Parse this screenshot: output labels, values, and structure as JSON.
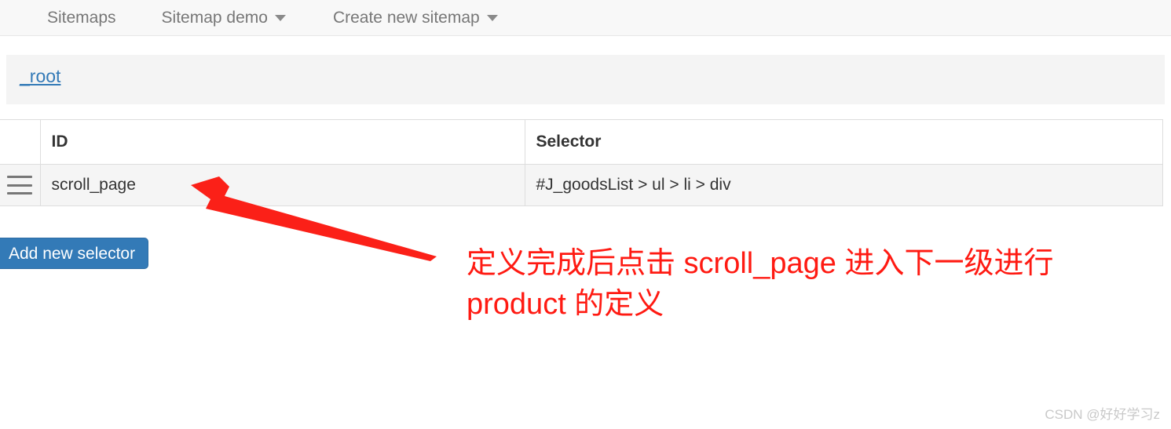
{
  "navbar": {
    "items": [
      {
        "label": "Sitemaps",
        "has_caret": false
      },
      {
        "label": "Sitemap demo",
        "has_caret": true
      },
      {
        "label": "Create new sitemap",
        "has_caret": true
      }
    ]
  },
  "breadcrumb": {
    "root_label": "_root"
  },
  "table": {
    "headers": {
      "handle": "",
      "id": "ID",
      "selector": "Selector"
    },
    "rows": [
      {
        "handle_icon": "drag-handle-icon",
        "id": "scroll_page",
        "selector": "#J_goodsList > ul > li > div"
      }
    ]
  },
  "actions": {
    "add_new_selector": "Add new selector"
  },
  "annotation": {
    "line1": "定义完成后点击 scroll_page 进入下一级进行",
    "line2": "product 的定义",
    "color": "#ff1a12",
    "arrow_icon": "arrow-pointing-up-left-icon"
  },
  "watermark": {
    "text": "CSDN @好好学习z"
  },
  "colors": {
    "navbar_bg": "#f8f8f8",
    "breadcrumb_bg": "#f4f4f4",
    "link_blue": "#337ab7",
    "button_blue": "#337ab7",
    "row_bg": "#f5f5f5",
    "annotation_red": "#ff1a12"
  }
}
